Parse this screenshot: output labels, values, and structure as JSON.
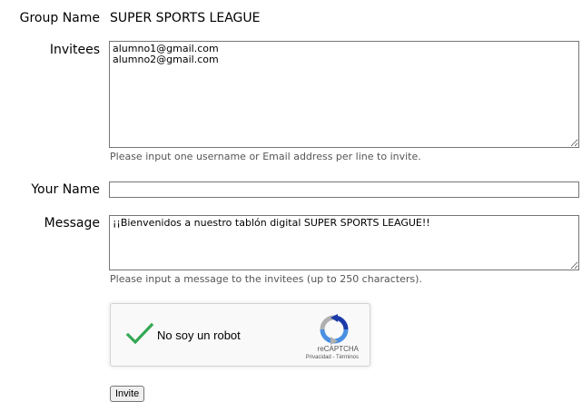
{
  "group": {
    "label": "Group Name",
    "value": "SUPER SPORTS LEAGUE"
  },
  "invitees": {
    "label": "Invitees",
    "value": "alumno1@gmail.com\nalumno2@gmail.com",
    "hint": "Please input one username or Email address per line to invite."
  },
  "your_name": {
    "label": "Your Name",
    "value": ""
  },
  "message": {
    "label": "Message",
    "value": "¡¡Bienvenidos a nuestro tablón digital SUPER SPORTS LEAGUE!!",
    "hint": "Please input a message to the invitees (up to 250 characters)."
  },
  "captcha": {
    "label": "No soy un robot",
    "brand": "reCAPTCHA",
    "privacy": "Privacidad",
    "separator": " - ",
    "terms": "Términos",
    "check_color": "#34a853",
    "logo_icon": "recaptcha-logo-icon"
  },
  "invite_button": {
    "label": "Invite"
  }
}
